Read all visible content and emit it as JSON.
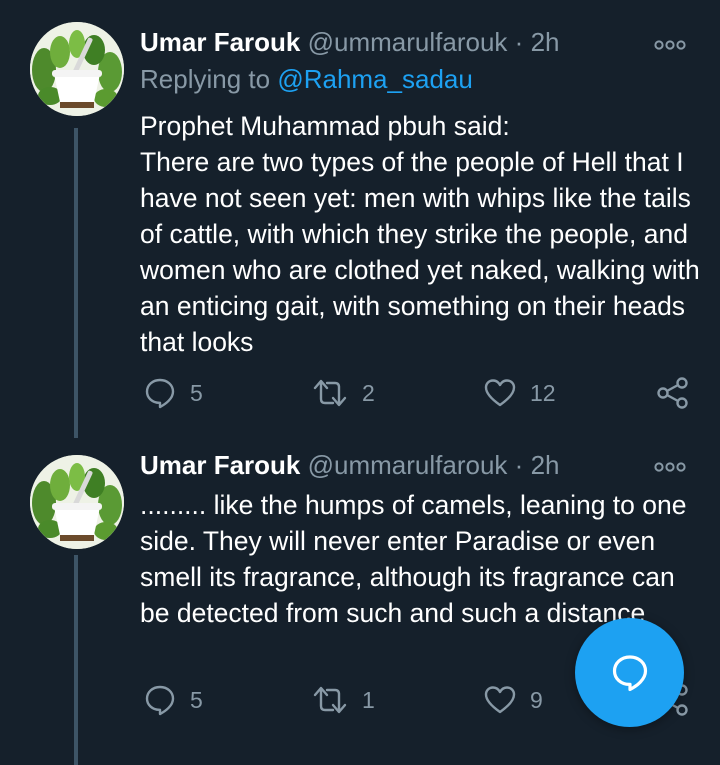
{
  "tweets": [
    {
      "author_name": "Umar Farouk",
      "handle": "@ummarulfarouk",
      "separator": "·",
      "time": "2h",
      "reply_prefix": "Replying to",
      "reply_mention": "@Rahma_sadau",
      "body_lines": [
        "Prophet Muhammad pbuh said:",
        "There are two types of the people of Hell that I have not seen yet: men with whips like the tails of cattle, with which they strike the people, and women who are clothed yet naked, walking with an enticing gait, with something on their heads that looks"
      ],
      "reply_count": "5",
      "retweet_count": "2",
      "like_count": "12",
      "avatar_icon": "herbs-mortar-avatar",
      "more_icon": "more-options-icon"
    },
    {
      "author_name": "Umar Farouk",
      "handle": "@ummarulfarouk",
      "separator": "·",
      "time": "2h",
      "body_lines": [
        "......... like the humps of camels, leaning to one side. They will never enter Paradise or even smell its fragrance, although its fragrance can be detected from such and such a distance"
      ],
      "reply_count": "5",
      "retweet_count": "1",
      "like_count": "9",
      "avatar_icon": "herbs-mortar-avatar",
      "more_icon": "more-options-icon"
    }
  ],
  "fab": {
    "icon": "compose-reply-icon"
  },
  "colors": {
    "background": "#15202b",
    "text": "#ffffff",
    "secondary": "#8899a6",
    "accent": "#1da1f2",
    "thread_line": "#3d5466"
  }
}
